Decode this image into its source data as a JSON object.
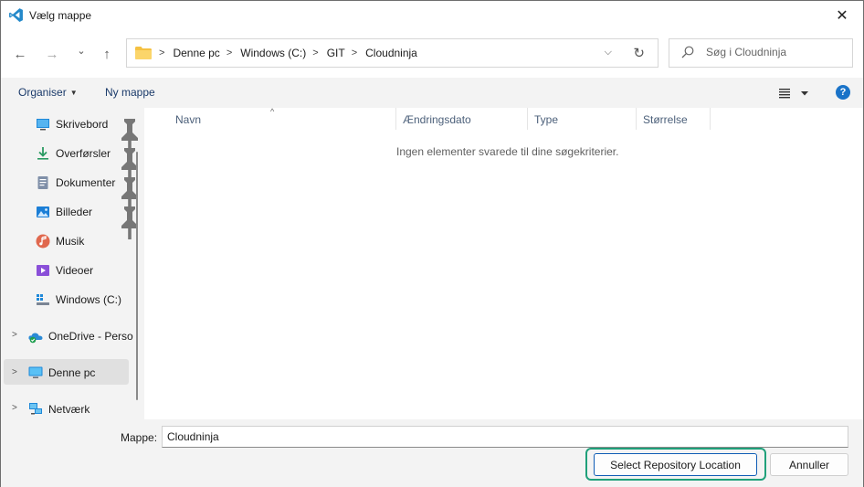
{
  "window": {
    "title": "Vælg mappe",
    "close_glyph": "✕"
  },
  "navigation": {
    "back_glyph": "←",
    "forward_glyph": "→",
    "recent_glyph": "⌄",
    "up_glyph": "↑",
    "breadcrumbs": [
      "Denne pc",
      "Windows (C:)",
      "GIT",
      "Cloudninja"
    ],
    "address_dropdown_glyph": "⌵",
    "refresh_glyph": "↻",
    "search_placeholder": "Søg i Cloudninja"
  },
  "toolbar": {
    "organize_label": "Organiser",
    "new_folder_label": "Ny mappe",
    "help_label": "?"
  },
  "sidebar": {
    "quick_access": [
      {
        "label": "Skrivebord",
        "icon": "desktop-icon",
        "pinned": true
      },
      {
        "label": "Overførsler",
        "icon": "download-icon",
        "pinned": true
      },
      {
        "label": "Dokumenter",
        "icon": "document-icon",
        "pinned": true
      },
      {
        "label": "Billeder",
        "icon": "pictures-icon",
        "pinned": true
      },
      {
        "label": "Musik",
        "icon": "music-icon",
        "pinned": false
      },
      {
        "label": "Videoer",
        "icon": "video-icon",
        "pinned": false
      },
      {
        "label": "Windows (C:)",
        "icon": "drive-icon",
        "pinned": false
      }
    ],
    "roots": [
      {
        "label": "OneDrive - Perso",
        "icon": "onedrive-icon"
      },
      {
        "label": "Denne pc",
        "icon": "computer-icon",
        "selected": true
      },
      {
        "label": "Netværk",
        "icon": "network-icon"
      }
    ]
  },
  "file_list": {
    "columns": [
      "Navn",
      "Ændringsdato",
      "Type",
      "Størrelse"
    ],
    "empty_message": "Ingen elementer svarede til dine søgekriterier."
  },
  "footer": {
    "folder_label": "Mappe:",
    "folder_value": "Cloudninja",
    "select_button": "Select Repository Location",
    "cancel_button": "Annuller"
  },
  "colors": {
    "accent": "#1a73c8",
    "highlight_border": "#1fa07a",
    "folder_yellow": "#f5c141"
  }
}
